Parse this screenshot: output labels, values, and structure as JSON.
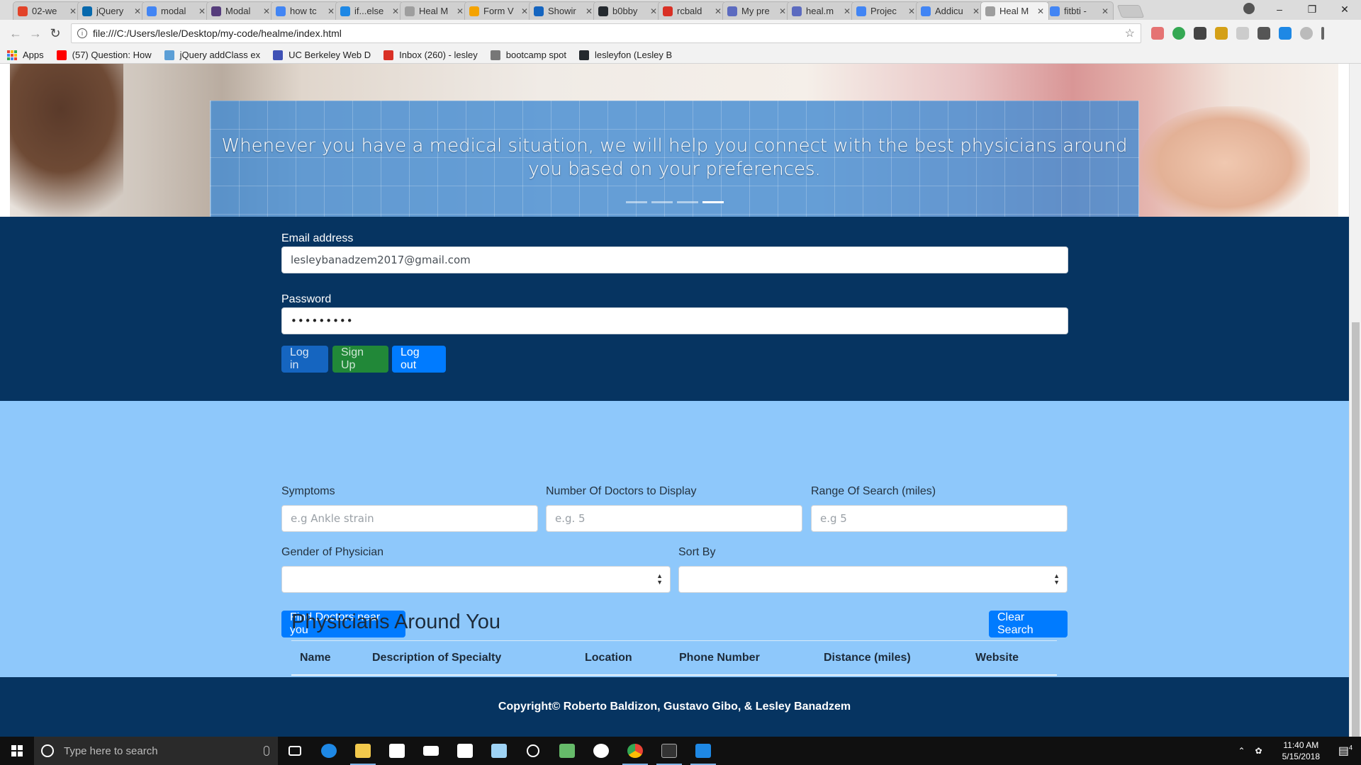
{
  "browser": {
    "tabs": [
      {
        "label": "02-we",
        "color": "#e24329",
        "icon": "gitlab-icon"
      },
      {
        "label": "jQuery",
        "color": "#0769ad",
        "icon": "jquery-icon"
      },
      {
        "label": "modal",
        "color": "#4285f4",
        "icon": "google-icon"
      },
      {
        "label": "Modal",
        "color": "#563d7c",
        "icon": "bootstrap-icon"
      },
      {
        "label": "how tc",
        "color": "#4285f4",
        "icon": "google-icon"
      },
      {
        "label": "if...else",
        "color": "#1e88e5",
        "icon": "mdn-icon"
      },
      {
        "label": "Heal M",
        "color": "#9e9e9e",
        "icon": "page-icon"
      },
      {
        "label": "Form V",
        "color": "#f4a300",
        "icon": "form-icon"
      },
      {
        "label": "Showir",
        "color": "#1565c0",
        "icon": "fv-icon"
      },
      {
        "label": "b0bby",
        "color": "#24292e",
        "icon": "github-icon"
      },
      {
        "label": "rcbald",
        "color": "#d93025",
        "icon": "gmail-icon"
      },
      {
        "label": "My pre",
        "color": "#5c6bc0",
        "icon": "globe-icon"
      },
      {
        "label": "heal.m",
        "color": "#5c6bc0",
        "icon": "globe-icon"
      },
      {
        "label": "Projec",
        "color": "#4285f4",
        "icon": "docs-icon"
      },
      {
        "label": "Addicu",
        "color": "#4285f4",
        "icon": "google-icon"
      },
      {
        "label": "Heal M",
        "color": "#9e9e9e",
        "icon": "page-icon",
        "active": true
      },
      {
        "label": "fitbti -",
        "color": "#4285f4",
        "icon": "google-icon"
      }
    ],
    "url": "file:///C:/Users/lesle/Desktop/my-code/healme/index.html",
    "bookmarks": [
      {
        "label": "Apps",
        "icon": "apps-icon",
        "color": "#4285f4"
      },
      {
        "label": "(57) Question: How",
        "icon": "youtube-icon",
        "color": "#ff0000"
      },
      {
        "label": "jQuery addClass ex",
        "icon": "cloud-icon",
        "color": "#5c9fd6"
      },
      {
        "label": "UC Berkeley Web D",
        "icon": "docs-icon",
        "color": "#3f51b5"
      },
      {
        "label": "Inbox (260) - lesley",
        "icon": "gmail-icon",
        "color": "#d93025"
      },
      {
        "label": "bootcamp spot",
        "icon": "page-icon",
        "color": "#777777"
      },
      {
        "label": "lesleyfon (Lesley B",
        "icon": "github-icon",
        "color": "#24292e"
      }
    ]
  },
  "hero": {
    "caption": "Whenever you have a medical situation, we will help you connect with the best physicians around you based on your preferences.",
    "indicators": [
      false,
      false,
      false,
      true
    ]
  },
  "login": {
    "email_label": "Email address",
    "email_value": "lesleybanadzem2017@gmail.com",
    "password_label": "Password",
    "password_value": "•••••••••",
    "login_button": "Log in",
    "signup_button": "Sign Up",
    "logout_button": "Log out",
    "bg_color": "#063461"
  },
  "search": {
    "symptoms_label": "Symptoms",
    "symptoms_placeholder": "e.g Ankle strain",
    "num_doctors_label": "Number Of Doctors to Display",
    "num_doctors_placeholder": "e.g. 5",
    "range_label": "Range Of Search (miles)",
    "range_placeholder": "e.g 5",
    "gender_label": "Gender of Physician",
    "gender_value": "",
    "sort_label": "Sort By",
    "sort_value": "",
    "find_button": "Find Doctors near you",
    "clear_button": "Clear Search",
    "bg_color": "#8ec8fb"
  },
  "results": {
    "title": "Physicians Around You",
    "columns": [
      "Name",
      "Description of Specialty",
      "Location",
      "Phone Number",
      "Distance (miles)",
      "Website"
    ]
  },
  "footer": {
    "text": "Copyright© Roberto Baldizon, Gustavo Gibo, & Lesley Banadzem"
  },
  "taskbar": {
    "search_placeholder": "Type here to search",
    "time": "11:40 AM",
    "date": "5/15/2018",
    "notification_count": "4"
  }
}
